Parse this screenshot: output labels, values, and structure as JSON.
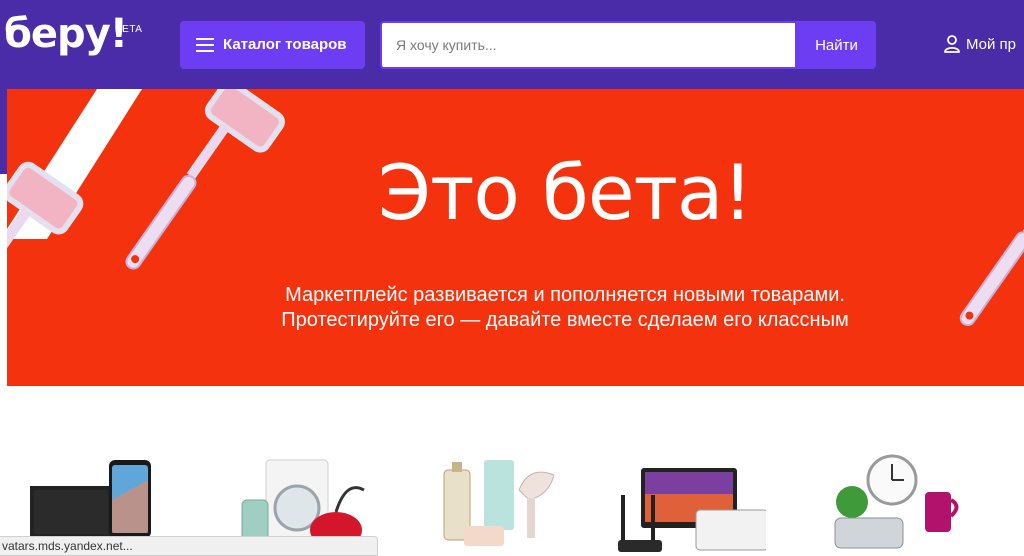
{
  "header": {
    "logo": "беру!",
    "beta": "BETA",
    "catalog_label": "Каталог товаров",
    "search": {
      "placeholder": "Я хочу купить...",
      "value": ""
    },
    "search_button": "Найти",
    "profile_label": "Мой пр"
  },
  "banner": {
    "title": "Это бета!",
    "subtitle_line1": "Маркетплейс развивается и пополняется новыми товарами.",
    "subtitle_line2": "Протестируйте его — давайте вместе сделаем его классным"
  },
  "categories": [
    {
      "icon": "electronics-icon"
    },
    {
      "icon": "home-appliances-icon"
    },
    {
      "icon": "beauty-products-icon"
    },
    {
      "icon": "computers-icon"
    },
    {
      "icon": "home-goods-icon"
    }
  ],
  "status_bar": {
    "text": "vatars.mds.yandex.net..."
  },
  "colors": {
    "header": "#4a2ba8",
    "accent": "#6c3df2",
    "banner": "#f4330e"
  }
}
